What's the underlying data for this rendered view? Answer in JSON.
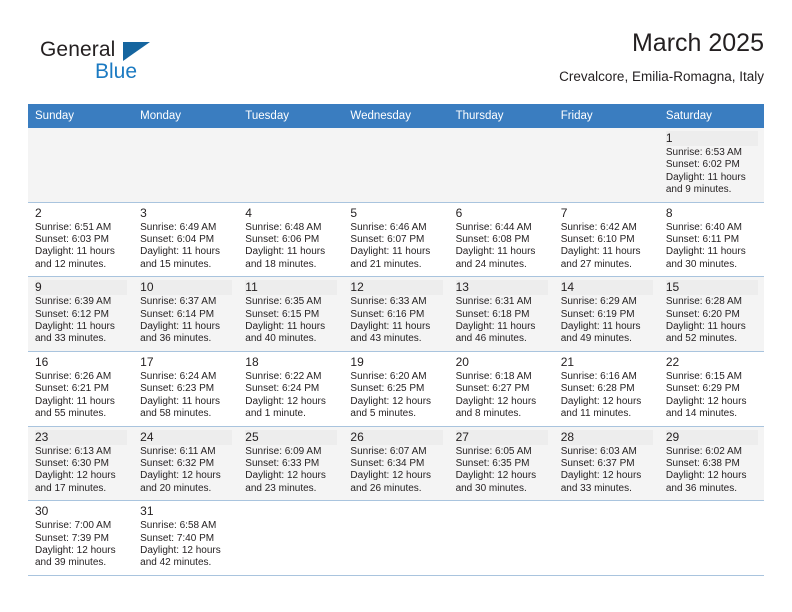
{
  "logo": {
    "word_dark": "General",
    "word_blue": "Blue",
    "icon": "blue-triangle-mark",
    "color_dark": "#231f20",
    "color_blue": "#1b7ac2"
  },
  "header": {
    "title": "March 2025",
    "subtitle": "Crevalcore, Emilia-Romagna, Italy"
  },
  "theme": {
    "header_row_bg": "#3a7dc0",
    "header_row_text": "#ffffff",
    "row_alt_bg": "#f4f4f4",
    "cell_border": "#a9c4de"
  },
  "calendar": {
    "weekday_headers": [
      "Sunday",
      "Monday",
      "Tuesday",
      "Wednesday",
      "Thursday",
      "Friday",
      "Saturday"
    ],
    "weeks": [
      [
        {
          "day": "",
          "detail": ""
        },
        {
          "day": "",
          "detail": ""
        },
        {
          "day": "",
          "detail": ""
        },
        {
          "day": "",
          "detail": ""
        },
        {
          "day": "",
          "detail": ""
        },
        {
          "day": "",
          "detail": ""
        },
        {
          "day": "1",
          "detail": "Sunrise: 6:53 AM\nSunset: 6:02 PM\nDaylight: 11 hours and 9 minutes."
        }
      ],
      [
        {
          "day": "2",
          "detail": "Sunrise: 6:51 AM\nSunset: 6:03 PM\nDaylight: 11 hours and 12 minutes."
        },
        {
          "day": "3",
          "detail": "Sunrise: 6:49 AM\nSunset: 6:04 PM\nDaylight: 11 hours and 15 minutes."
        },
        {
          "day": "4",
          "detail": "Sunrise: 6:48 AM\nSunset: 6:06 PM\nDaylight: 11 hours and 18 minutes."
        },
        {
          "day": "5",
          "detail": "Sunrise: 6:46 AM\nSunset: 6:07 PM\nDaylight: 11 hours and 21 minutes."
        },
        {
          "day": "6",
          "detail": "Sunrise: 6:44 AM\nSunset: 6:08 PM\nDaylight: 11 hours and 24 minutes."
        },
        {
          "day": "7",
          "detail": "Sunrise: 6:42 AM\nSunset: 6:10 PM\nDaylight: 11 hours and 27 minutes."
        },
        {
          "day": "8",
          "detail": "Sunrise: 6:40 AM\nSunset: 6:11 PM\nDaylight: 11 hours and 30 minutes."
        }
      ],
      [
        {
          "day": "9",
          "detail": "Sunrise: 6:39 AM\nSunset: 6:12 PM\nDaylight: 11 hours and 33 minutes."
        },
        {
          "day": "10",
          "detail": "Sunrise: 6:37 AM\nSunset: 6:14 PM\nDaylight: 11 hours and 36 minutes."
        },
        {
          "day": "11",
          "detail": "Sunrise: 6:35 AM\nSunset: 6:15 PM\nDaylight: 11 hours and 40 minutes."
        },
        {
          "day": "12",
          "detail": "Sunrise: 6:33 AM\nSunset: 6:16 PM\nDaylight: 11 hours and 43 minutes."
        },
        {
          "day": "13",
          "detail": "Sunrise: 6:31 AM\nSunset: 6:18 PM\nDaylight: 11 hours and 46 minutes."
        },
        {
          "day": "14",
          "detail": "Sunrise: 6:29 AM\nSunset: 6:19 PM\nDaylight: 11 hours and 49 minutes."
        },
        {
          "day": "15",
          "detail": "Sunrise: 6:28 AM\nSunset: 6:20 PM\nDaylight: 11 hours and 52 minutes."
        }
      ],
      [
        {
          "day": "16",
          "detail": "Sunrise: 6:26 AM\nSunset: 6:21 PM\nDaylight: 11 hours and 55 minutes."
        },
        {
          "day": "17",
          "detail": "Sunrise: 6:24 AM\nSunset: 6:23 PM\nDaylight: 11 hours and 58 minutes."
        },
        {
          "day": "18",
          "detail": "Sunrise: 6:22 AM\nSunset: 6:24 PM\nDaylight: 12 hours and 1 minute."
        },
        {
          "day": "19",
          "detail": "Sunrise: 6:20 AM\nSunset: 6:25 PM\nDaylight: 12 hours and 5 minutes."
        },
        {
          "day": "20",
          "detail": "Sunrise: 6:18 AM\nSunset: 6:27 PM\nDaylight: 12 hours and 8 minutes."
        },
        {
          "day": "21",
          "detail": "Sunrise: 6:16 AM\nSunset: 6:28 PM\nDaylight: 12 hours and 11 minutes."
        },
        {
          "day": "22",
          "detail": "Sunrise: 6:15 AM\nSunset: 6:29 PM\nDaylight: 12 hours and 14 minutes."
        }
      ],
      [
        {
          "day": "23",
          "detail": "Sunrise: 6:13 AM\nSunset: 6:30 PM\nDaylight: 12 hours and 17 minutes."
        },
        {
          "day": "24",
          "detail": "Sunrise: 6:11 AM\nSunset: 6:32 PM\nDaylight: 12 hours and 20 minutes."
        },
        {
          "day": "25",
          "detail": "Sunrise: 6:09 AM\nSunset: 6:33 PM\nDaylight: 12 hours and 23 minutes."
        },
        {
          "day": "26",
          "detail": "Sunrise: 6:07 AM\nSunset: 6:34 PM\nDaylight: 12 hours and 26 minutes."
        },
        {
          "day": "27",
          "detail": "Sunrise: 6:05 AM\nSunset: 6:35 PM\nDaylight: 12 hours and 30 minutes."
        },
        {
          "day": "28",
          "detail": "Sunrise: 6:03 AM\nSunset: 6:37 PM\nDaylight: 12 hours and 33 minutes."
        },
        {
          "day": "29",
          "detail": "Sunrise: 6:02 AM\nSunset: 6:38 PM\nDaylight: 12 hours and 36 minutes."
        }
      ],
      [
        {
          "day": "30",
          "detail": "Sunrise: 7:00 AM\nSunset: 7:39 PM\nDaylight: 12 hours and 39 minutes."
        },
        {
          "day": "31",
          "detail": "Sunrise: 6:58 AM\nSunset: 7:40 PM\nDaylight: 12 hours and 42 minutes."
        },
        {
          "day": "",
          "detail": ""
        },
        {
          "day": "",
          "detail": ""
        },
        {
          "day": "",
          "detail": ""
        },
        {
          "day": "",
          "detail": ""
        },
        {
          "day": "",
          "detail": ""
        }
      ]
    ]
  }
}
